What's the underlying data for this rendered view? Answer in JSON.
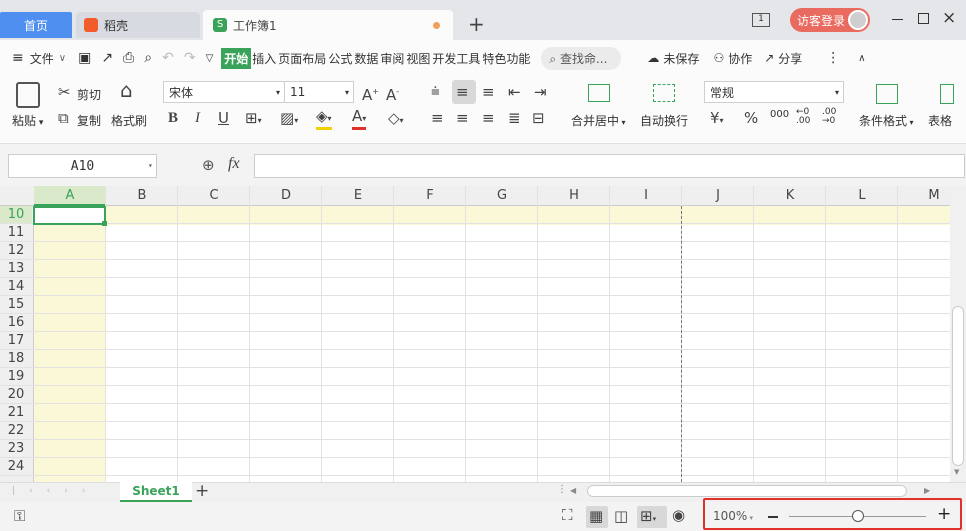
{
  "tabs": {
    "home": "首页",
    "daoke": "稻壳",
    "workbook": "工作簿1",
    "new": "+"
  },
  "titlebar": {
    "login": "访客登录"
  },
  "menu": {
    "file": "文件",
    "items": [
      "开始",
      "插入",
      "页面布局",
      "公式",
      "数据",
      "审阅",
      "视图",
      "开发工具",
      "特色功能"
    ],
    "search": "查找命...",
    "unsaved": "未保存",
    "collab": "协作",
    "share": "分享"
  },
  "ribbon": {
    "paste": "粘贴",
    "cut": "剪切",
    "copy": "复制",
    "format_painter": "格式刷",
    "font": "宋体",
    "size": "11",
    "merge": "合并居中",
    "wrap": "自动换行",
    "number_format": "常规",
    "cond_format": "条件格式",
    "table_style": "表格"
  },
  "formula": {
    "cell": "A10",
    "fx": "fx",
    "value": ""
  },
  "grid": {
    "columns": [
      "A",
      "B",
      "C",
      "D",
      "E",
      "F",
      "G",
      "H",
      "I",
      "J",
      "K",
      "L",
      "M"
    ],
    "rows": [
      "10",
      "11",
      "12",
      "13",
      "14",
      "15",
      "16",
      "17",
      "18",
      "19",
      "20",
      "21",
      "22",
      "23",
      "24"
    ]
  },
  "sheets": {
    "active": "Sheet1",
    "add": "+"
  },
  "status": {
    "zoom": "100%",
    "zoom_percent": 100
  },
  "colors": {
    "accent": "#4e8ff0",
    "green": "#3aa35a",
    "highlight": "#fbf8d8",
    "header_active": "#d9e9c9",
    "red_box": "#e0322a"
  }
}
